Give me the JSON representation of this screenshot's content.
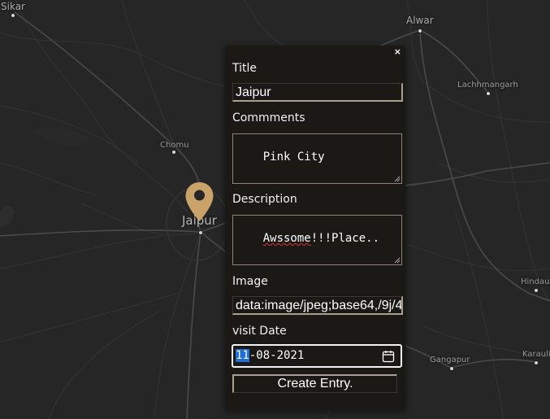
{
  "map": {
    "cities": [
      {
        "name": "Sikar",
        "size": "normal"
      },
      {
        "name": "Alwar",
        "size": "normal"
      },
      {
        "name": "Lachhmangarh",
        "size": "small"
      },
      {
        "name": "Chomu",
        "size": "small"
      },
      {
        "name": "Jaipur",
        "size": "big"
      },
      {
        "name": "Hindau",
        "size": "small"
      },
      {
        "name": "Gangapur",
        "size": "small"
      },
      {
        "name": "Karauli",
        "size": "small"
      }
    ],
    "marker_icon": "map-pin-icon",
    "marker_color": "#c9a36a"
  },
  "popup": {
    "close_label": "×",
    "title_label": "Title",
    "title_value": "Jaipur",
    "comments_label": "Commments",
    "comments_value": "Pink City",
    "description_label": "Description",
    "description_value": "Awssome!!!Place..",
    "image_label": "Image",
    "image_value": "data:image/jpeg;base64,/9j/4",
    "visit_date_label": "visit Date",
    "date_day": "11",
    "date_rest": "-08-2021",
    "calendar_icon": "calendar-icon",
    "submit_label": "Create Entry."
  },
  "colors": {
    "map_background": "#262626",
    "popup_background": "#1a1916",
    "date_highlight": "#1e6fd6"
  }
}
